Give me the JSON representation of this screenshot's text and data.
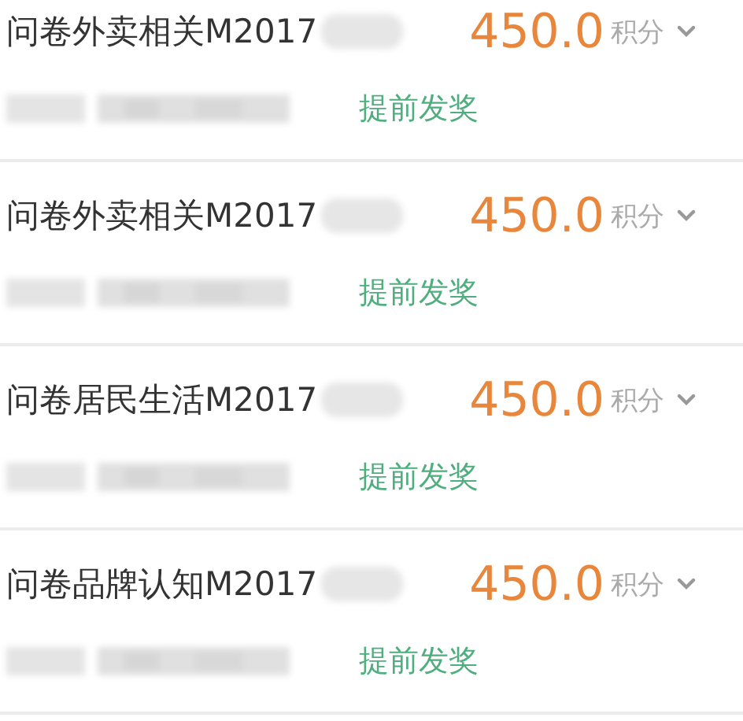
{
  "records": [
    {
      "title": "问卷外卖相关M2017",
      "points": "450.0",
      "unit": "积分",
      "action": "提前发奖",
      "expanded": false
    },
    {
      "title": "问卷外卖相关M2017",
      "points": "450.0",
      "unit": "积分",
      "action": "提前发奖",
      "expanded": false
    },
    {
      "title": "问卷居民生活M2017",
      "points": "450.0",
      "unit": "积分",
      "action": "提前发奖",
      "expanded": false
    },
    {
      "title": "问卷品牌认知M2017",
      "points": "450.0",
      "unit": "积分",
      "action": "提前发奖",
      "expanded": false
    }
  ]
}
